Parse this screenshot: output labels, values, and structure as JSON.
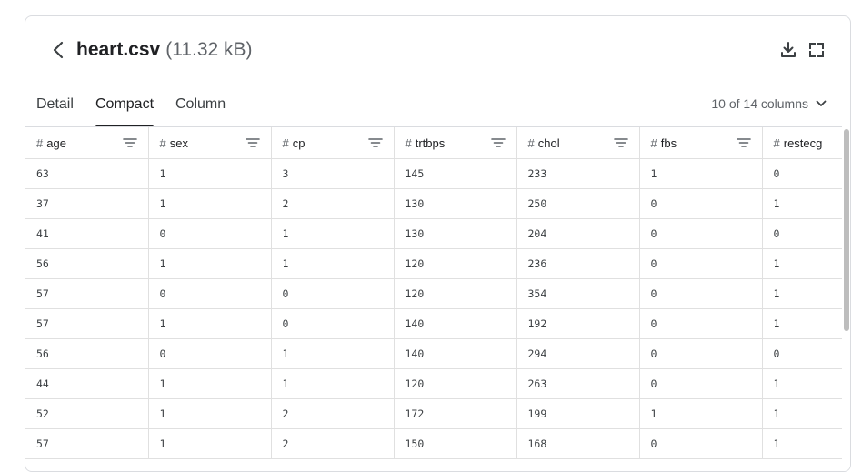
{
  "header": {
    "filename": "heart.csv",
    "filesize": "(11.32 kB)"
  },
  "tabs": [
    {
      "label": "Detail",
      "active": false
    },
    {
      "label": "Compact",
      "active": true
    },
    {
      "label": "Column",
      "active": false
    }
  ],
  "columns_selector": {
    "label": "10 of 14 columns"
  },
  "table": {
    "headers": [
      "age",
      "sex",
      "cp",
      "trtbps",
      "chol",
      "fbs",
      "restecg"
    ],
    "rows": [
      [
        "63",
        "1",
        "3",
        "145",
        "233",
        "1",
        "0"
      ],
      [
        "37",
        "1",
        "2",
        "130",
        "250",
        "0",
        "1"
      ],
      [
        "41",
        "0",
        "1",
        "130",
        "204",
        "0",
        "0"
      ],
      [
        "56",
        "1",
        "1",
        "120",
        "236",
        "0",
        "1"
      ],
      [
        "57",
        "0",
        "0",
        "120",
        "354",
        "0",
        "1"
      ],
      [
        "57",
        "1",
        "0",
        "140",
        "192",
        "0",
        "1"
      ],
      [
        "56",
        "0",
        "1",
        "140",
        "294",
        "0",
        "0"
      ],
      [
        "44",
        "1",
        "1",
        "120",
        "263",
        "0",
        "1"
      ],
      [
        "52",
        "1",
        "2",
        "172",
        "199",
        "1",
        "1"
      ],
      [
        "57",
        "1",
        "2",
        "150",
        "168",
        "0",
        "1"
      ]
    ]
  }
}
